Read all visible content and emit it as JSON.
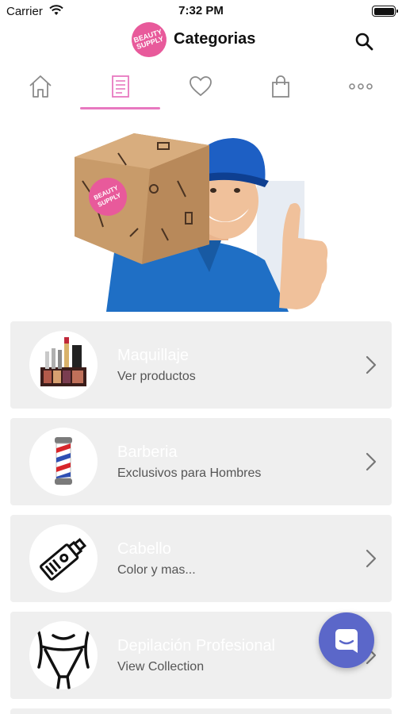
{
  "status_bar": {
    "carrier": "Carrier",
    "time": "7:32 PM"
  },
  "header": {
    "logo_text_line1": "BEAUTY",
    "logo_text_line2": "SUPPLY",
    "title": "Categorias"
  },
  "tabs": [
    {
      "icon": "home-icon"
    },
    {
      "icon": "list-icon",
      "active": true
    },
    {
      "icon": "heart-icon"
    },
    {
      "icon": "bag-icon"
    },
    {
      "icon": "more-icon"
    }
  ],
  "banner": {
    "box_logo_line1": "BEAUTY",
    "box_logo_line2": "SUPPLY"
  },
  "categories": [
    {
      "title": "Maquillaje",
      "subtitle": "Ver productos",
      "icon": "makeup-icon"
    },
    {
      "title": "Barberia",
      "subtitle": "Exclusivos para Hombres",
      "icon": "barber-pole-icon"
    },
    {
      "title": "Cabello",
      "subtitle": "Color y mas...",
      "icon": "hair-tube-icon"
    },
    {
      "title": "Depilación Profesional",
      "subtitle": "View Collection",
      "icon": "waxing-icon"
    }
  ],
  "colors": {
    "accent_pink": "#e879c0",
    "brand_pink": "#e85a9b",
    "chat_button": "#5b67c9",
    "card_bg": "#efefef"
  }
}
